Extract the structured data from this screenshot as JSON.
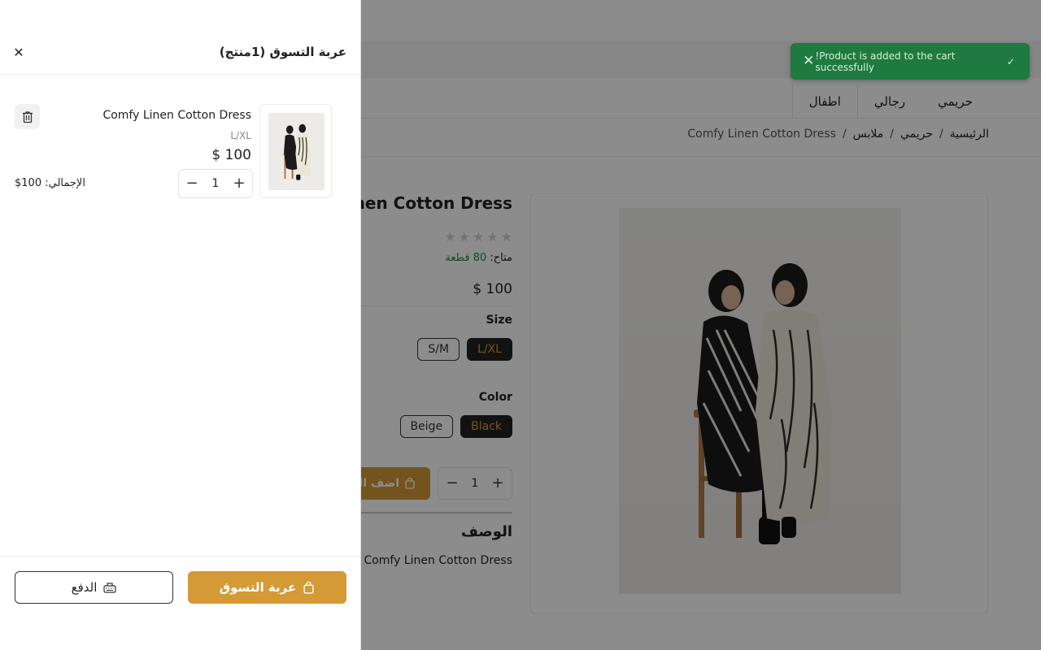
{
  "toast": {
    "message": "!Product is added to the cart successfully"
  },
  "nav": {
    "items": [
      "حريمي",
      "رجالي",
      "اطفال"
    ]
  },
  "breadcrumb": {
    "home": "الرئيسية",
    "women": "حريمي",
    "clothes": "ملابس",
    "current": "Comfy Linen Cotton Dress",
    "separator": "/"
  },
  "product": {
    "title": "Comfy Linen Cotton Dress",
    "rating": 0,
    "availability_label": "متاح:",
    "availability_value": "80 قطعة",
    "price": "$ 100",
    "size_label": "Size",
    "sizes": [
      "L/XL",
      "S/M"
    ],
    "selected_size": "L/XL",
    "color_label": "Color",
    "colors": [
      "Black",
      "Beige"
    ],
    "selected_color": "Black",
    "quantity": "1",
    "add_to_cart_label": "اضف ال",
    "description_title": "الوصف",
    "description_text": "Comfy Linen Cotton Dress"
  },
  "drawer": {
    "title": "عربة التسوق (1منتج)",
    "item": {
      "name": "Comfy Linen Cotton Dress",
      "variant": "L/XL",
      "price": "$ 100",
      "quantity": "1",
      "total": "الإجمالي: 100$"
    },
    "cart_button": "عربة التسوق",
    "checkout_button": "الدفع"
  },
  "colors": {
    "accent": "#d39a35",
    "success": "#1e7a3e",
    "dark": "#222222"
  },
  "icons": [
    "close-icon",
    "check-icon",
    "trash-icon",
    "minus-icon",
    "plus-icon",
    "bag-icon",
    "card-icon",
    "star-icon"
  ]
}
